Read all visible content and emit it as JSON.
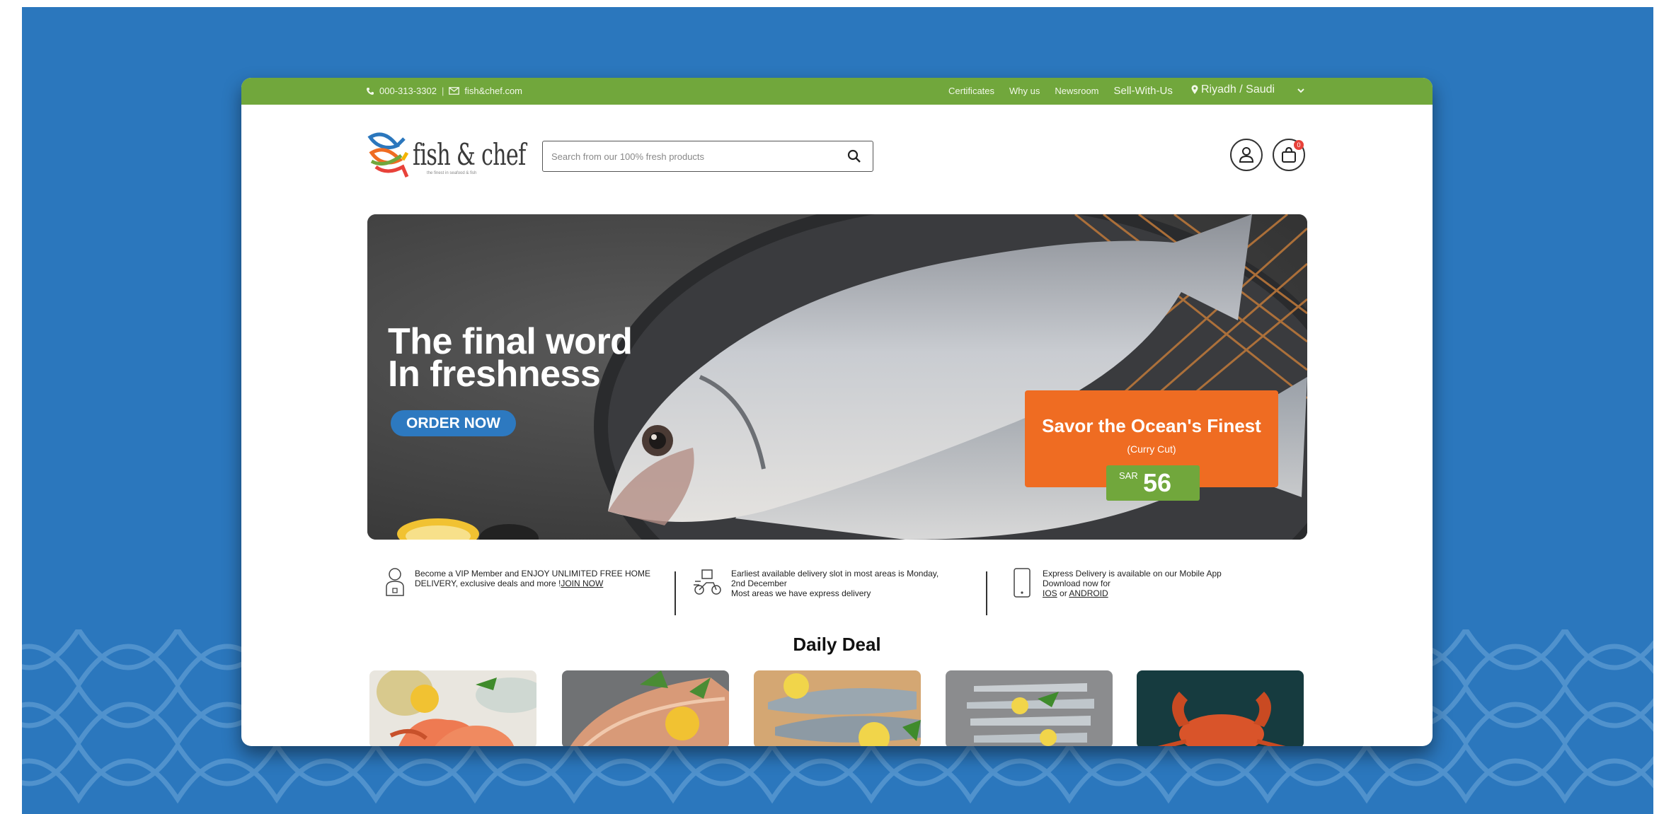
{
  "topbar": {
    "phone": "000-313-3302",
    "separator": "|",
    "email": "fish&chef.com",
    "links": [
      "Certificates",
      "Why us",
      "Newsroom",
      "Sell-With-Us"
    ],
    "location": "Riyadh / Saudi"
  },
  "brand": {
    "logo_text": "fish & chef",
    "tagline": "the finest in seafood & fish"
  },
  "search": {
    "placeholder": "Search from our 100% fresh products"
  },
  "header": {
    "cart_count": "0"
  },
  "hero": {
    "headline_line1": "The final word",
    "headline_line2": "In freshness",
    "cta_label": "ORDER NOW",
    "promo_title": "Savor the Ocean's Finest",
    "promo_subtitle": "(Curry Cut)",
    "price_currency": "SAR",
    "price_value": "56"
  },
  "info": {
    "vip_text_1": "Become a VIP Member and ENJOY UNLIMITED FREE HOME",
    "vip_text_2": "DELIVERY, exclusive deals and more !",
    "vip_link": "JOIN NOW",
    "delivery_line1": "Earliest available delivery slot in most areas is Monday,",
    "delivery_line2": "2nd December",
    "delivery_line3": "Most areas we have express delivery",
    "app_line1": "Express Delivery is available on our Mobile App",
    "app_line2": "Download now for",
    "app_ios": "IOS",
    "app_or": "or",
    "app_android": "ANDROID"
  },
  "daily_deal": {
    "title": "Daily Deal",
    "items": [
      "shrimp",
      "salmon fillet",
      "mackerel",
      "sardines",
      "crab"
    ]
  },
  "colors": {
    "backdrop": "#2b77bd",
    "topbar": "#71a73c",
    "cta": "#2d79c0",
    "promo": "#ef6c22",
    "price": "#71a73c"
  }
}
